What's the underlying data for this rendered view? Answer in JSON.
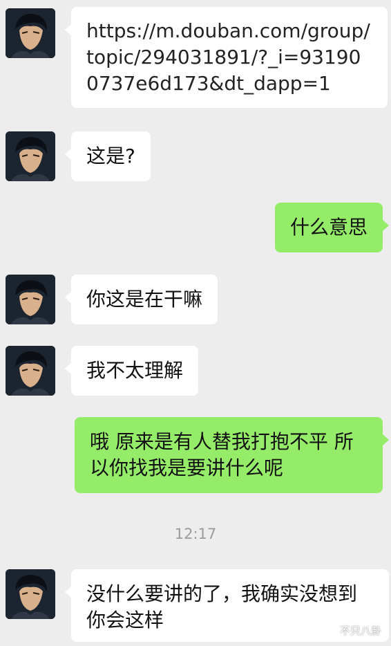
{
  "messages": [
    {
      "id": "m1",
      "side": "in",
      "text": "https://m.douban.com/group/topic/294031891/?_i=931900737e6d173&dt_dapp=1"
    },
    {
      "id": "m2",
      "side": "in",
      "text": "这是?"
    },
    {
      "id": "m3",
      "side": "out",
      "text": "什么意思"
    },
    {
      "id": "m4",
      "side": "in",
      "text": "你这是在干嘛"
    },
    {
      "id": "m5",
      "side": "in",
      "text": "我不太理解"
    },
    {
      "id": "m6",
      "side": "out",
      "text": "哦 原来是有人替我打抱不平 所以你找我是要讲什么呢"
    },
    {
      "id": "m7",
      "side": "in",
      "text": "没什么要讲的了，我确实没想到你会这样"
    }
  ],
  "timestamp": "12:17",
  "watermark": {
    "text": "不只八卦",
    "icon": "wechat-channel-icon"
  },
  "colors": {
    "background": "#ededed",
    "incoming": "#ffffff",
    "outgoing": "#95ec69"
  }
}
